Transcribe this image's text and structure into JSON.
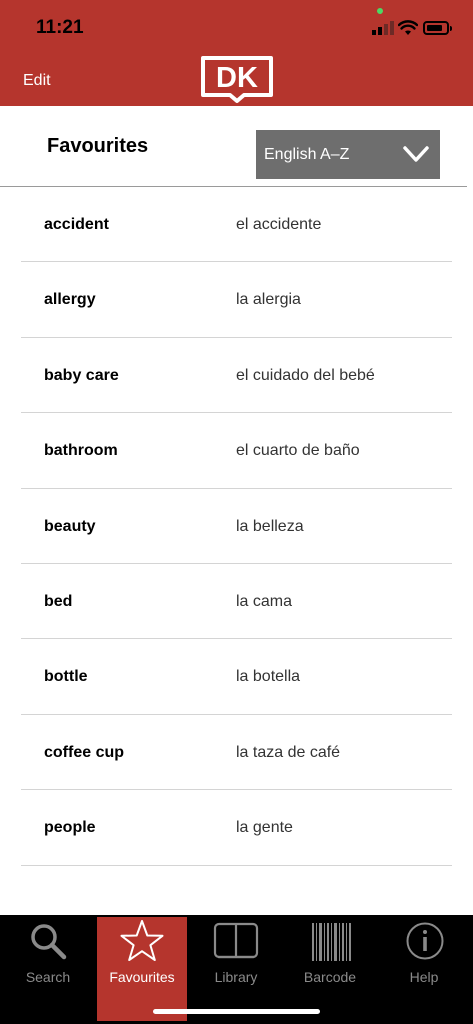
{
  "status_bar": {
    "time": "11:21"
  },
  "header": {
    "edit_label": "Edit",
    "logo_text": "DK"
  },
  "favourites": {
    "title": "Favourites",
    "sort": {
      "selected": "English A–Z"
    },
    "entries": [
      {
        "english": "accident",
        "spanish": "el accidente"
      },
      {
        "english": "allergy",
        "spanish": "la alergia"
      },
      {
        "english": "baby care",
        "spanish": "el cuidado del bebé"
      },
      {
        "english": "bathroom",
        "spanish": "el cuarto de baño"
      },
      {
        "english": "beauty",
        "spanish": "la belleza"
      },
      {
        "english": "bed",
        "spanish": "la cama"
      },
      {
        "english": "bottle",
        "spanish": "la botella"
      },
      {
        "english": "coffee cup",
        "spanish": "la taza de café"
      },
      {
        "english": "people",
        "spanish": "la gente"
      }
    ]
  },
  "tabbar": {
    "tabs": [
      {
        "label": "Search",
        "icon": "search-icon",
        "active": false
      },
      {
        "label": "Favourites",
        "icon": "star-icon",
        "active": true
      },
      {
        "label": "Library",
        "icon": "book-icon",
        "active": false
      },
      {
        "label": "Barcode",
        "icon": "barcode-icon",
        "active": false
      },
      {
        "label": "Help",
        "icon": "info-icon",
        "active": false
      }
    ]
  },
  "colors": {
    "brand_red": "#b5352d",
    "select_gray": "#6e6e6e",
    "tab_bg": "#000000"
  }
}
